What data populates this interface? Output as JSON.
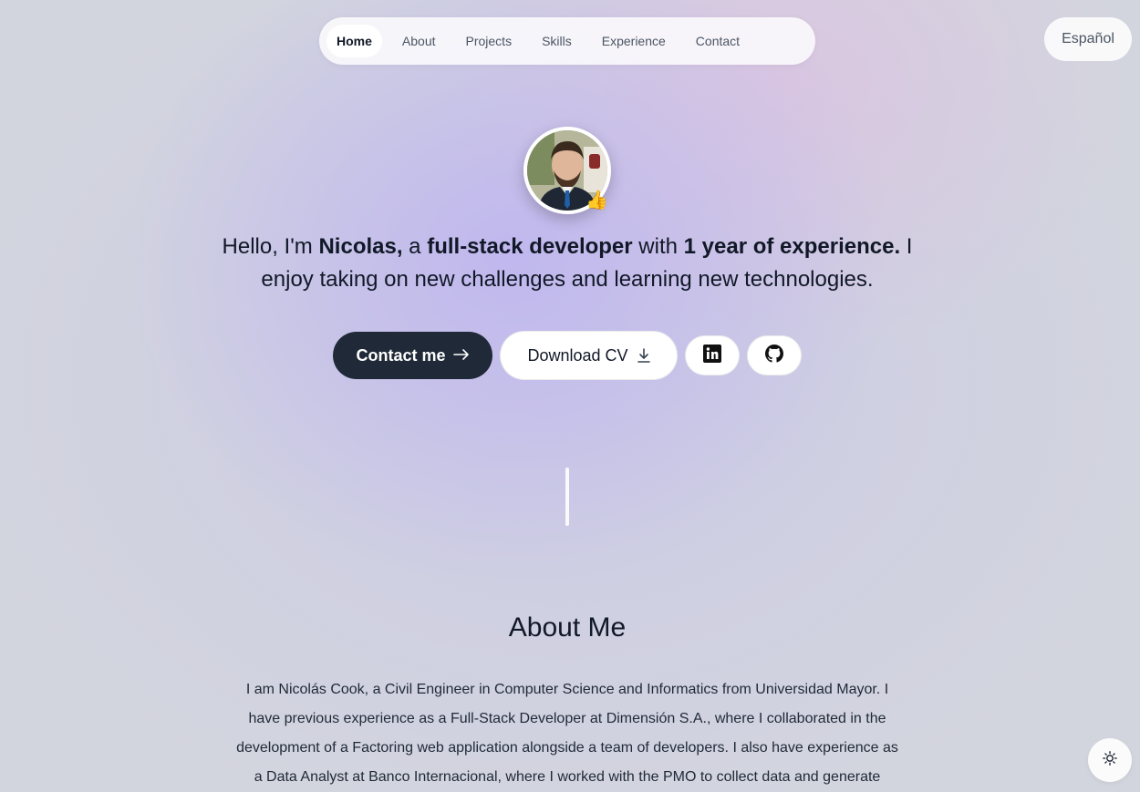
{
  "nav": {
    "items": [
      {
        "label": "Home",
        "active": true
      },
      {
        "label": "About",
        "active": false
      },
      {
        "label": "Projects",
        "active": false
      },
      {
        "label": "Skills",
        "active": false
      },
      {
        "label": "Experience",
        "active": false
      },
      {
        "label": "Contact",
        "active": false
      }
    ]
  },
  "language_toggle": {
    "label": "Español"
  },
  "hero": {
    "avatar_badge_icon": "thumbs-up-emoji",
    "intro_prefix": "Hello, I'm ",
    "name": "Nicolas,",
    "mid1": " a ",
    "role": "full-stack developer",
    "mid2": " with ",
    "experience": "1 year of experience.",
    "suffix": " I enjoy taking on new challenges and learning new technologies."
  },
  "actions": {
    "contact_label": "Contact me",
    "contact_icon": "arrow-right-icon",
    "download_label": "Download CV",
    "download_icon": "download-icon",
    "linkedin_icon": "linkedin-icon",
    "github_icon": "github-icon"
  },
  "about": {
    "title": "About Me",
    "text": "I am Nicolás Cook, a Civil Engineer in Computer Science and Informatics from Universidad Mayor. I have previous experience as a Full-Stack Developer at Dimensión S.A., where I collaborated in the development of a Factoring web application alongside a team of developers. I also have experience as a Data Analyst at Banco Internacional, where I worked with the PMO to collect data and generate"
  },
  "theme_toggle": {
    "icon": "sun-icon"
  },
  "colors": {
    "primary_button": "#1f2937",
    "text": "#111827",
    "muted_text": "#4b5563"
  }
}
